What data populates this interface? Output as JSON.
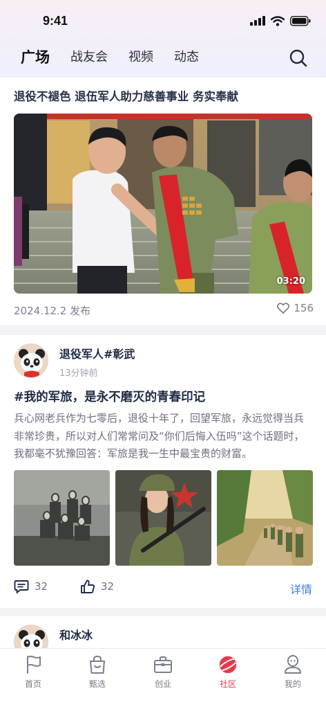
{
  "status_bar": {
    "time": "9:41"
  },
  "tabs": [
    {
      "label": "广场",
      "active": true
    },
    {
      "label": "战友会",
      "active": false
    },
    {
      "label": "视频",
      "active": false
    },
    {
      "label": "动态",
      "active": false
    }
  ],
  "video_card": {
    "title": "退役不褪色 退伍军人助力慈善事业 务实奉献",
    "duration": "03:20",
    "date": "2024.12.2 发布",
    "likes": "156"
  },
  "post": {
    "author": "退役军人#彰武",
    "time": "13分钟前",
    "title": "#我的军旅，是永不磨灭的青春印记",
    "body": "兵心网老兵作为七零后，退役十年了，回望军旅，永远觉得当兵非常珍贵，所以对人们常常问及“你们后悔入伍吗”这个话题时，我都毫不犹豫回答：军旅是我一生中最宝贵的财富。",
    "comments": "32",
    "likes": "32",
    "detail_label": "详情"
  },
  "next_post": {
    "author": "和冰冰"
  },
  "bottom_nav": [
    {
      "label": "首页",
      "icon": "flag-icon",
      "active": false
    },
    {
      "label": "甄选",
      "icon": "shopping-bag-icon",
      "active": false
    },
    {
      "label": "创业",
      "icon": "briefcase-icon",
      "active": false
    },
    {
      "label": "社区",
      "icon": "planet-icon",
      "active": true
    },
    {
      "label": "我的",
      "icon": "profile-icon",
      "active": false
    }
  ],
  "colors": {
    "accent_red": "#e8394a",
    "link_blue": "#3d7be0",
    "title_navy": "#1f2a44"
  }
}
